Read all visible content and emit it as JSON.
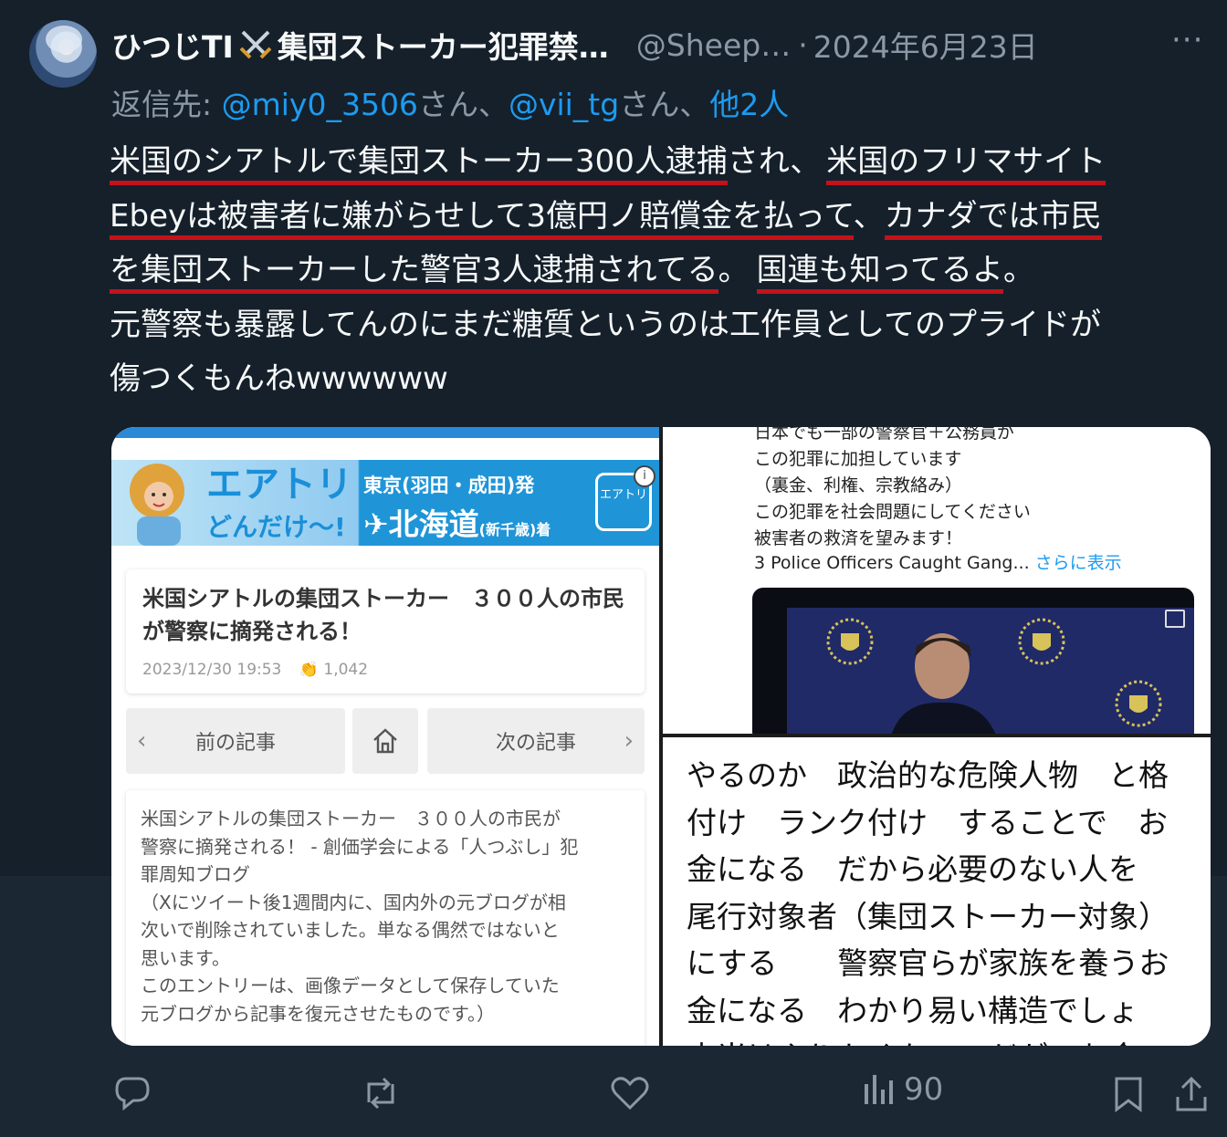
{
  "post": {
    "author_name": "ひつじTI",
    "author_name_rest": "集団ストーカー犯罪禁…",
    "handle": "@Sheep…",
    "separator": "·",
    "date": "2024年6月23日",
    "more": "···"
  },
  "reply": {
    "prefix": "返信先: ",
    "mention1": "@miy0_3506",
    "san1": "さん、",
    "mention2": "@vii_tg",
    "san2": "さん、",
    "others": "他2人"
  },
  "body": {
    "l1a": "米国のシアトルで集団ストーカー300人逮捕",
    "l1b": "され、",
    "l1c": "米国のフリマサイト",
    "l2a": "Ebeyは被害者に嫌がらせして3億円ノ賠償金を払って",
    "l2b": "、",
    "l2c": "カナダでは市民",
    "l3a": "を集団ストーカーした警官3人逮捕されてる",
    "l3b": "。",
    "l3c": "国連も知ってるよ",
    "l3d": "。",
    "l4": "元警察も暴露してんのにまだ糖質というのは工作員としてのプライドが",
    "l5": "傷つくもんねwwwwww"
  },
  "media": {
    "ad": {
      "brand_line1": "エアトリ",
      "brand_line2": "どんだけ〜!",
      "route_line1": "東京(羽田・成田)発",
      "route_line2": "✈北海道",
      "route_line2_small": "(新千歳)着",
      "logo_text": "エアトリ",
      "info": "i"
    },
    "article": {
      "title": "米国シアトルの集団ストーカー　３００人の市民が警察に摘発される！",
      "date": "2023/12/30 19:53",
      "clap_icon": "👏",
      "claps": "1,042"
    },
    "nav": {
      "prev": "前の記事",
      "next": "次の記事",
      "prev_arrow": "‹",
      "next_arrow": "›"
    },
    "excerpt": "米国シアトルの集団ストーカー　３００人の市民が\n警察に摘発される！ - 創価学会による「人つぶし」犯\n罪周知ブログ\n（Xにツイート後1週間内に、国内外の元ブログが相\n次いで削除されていました。単なる偶然ではないと\n思います。\nこのエントリーは、画像データとして保存していた\n元ブログから記事を復元させたものです。）",
    "right_top": {
      "text": "日本でも一部の警察官＋公務員が\nこの犯罪に加担しています\n（裏金、利権、宗教絡み）\nこの犯罪を社会問題にしてください\n被害者の救済を望みます！",
      "link_line": "3 Police Officers Caught Gang...",
      "show_more": "さらに表示"
    },
    "right_bottom": {
      "text": "やるのか　政治的な危険人物　と格\n付け　ランク付け　することで　お\n金になる　だから必要のない人を\n尾行対象者（集団ストーカー対象）\nにする　　警察官らが家族を養うお\n金になる　わかり易い構造でしょ\n本当はやりたくないのだが　お金の"
    }
  },
  "actions": {
    "views": "90"
  },
  "colors": {
    "background": "#15202b",
    "text": "#f7f9f9",
    "muted": "#8b98a5",
    "link": "#1d9bf0",
    "underline": "#c4121a"
  }
}
